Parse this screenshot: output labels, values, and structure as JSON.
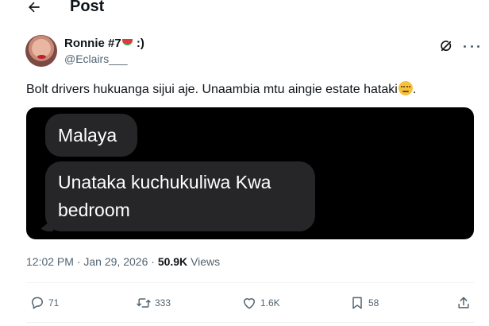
{
  "header": {
    "title": "Post"
  },
  "post": {
    "author_name": "Ronnie #7",
    "author_name_suffix": " :)",
    "handle": "@Eclairs___",
    "text": "Bolt drivers hukuanga sijui aje.  Unaambia mtu aingie estate hataki",
    "text_end": ".",
    "image_messages": [
      "Malaya",
      "Unataka kuchukuliwa Kwa bedroom"
    ],
    "time": "12:02 PM",
    "separator": "·",
    "date": "Jan 29, 2026",
    "views_count": "50.9K",
    "views_label": "Views"
  },
  "actions": {
    "replies": "71",
    "reposts": "333",
    "likes": "1.6K",
    "bookmarks": "58"
  },
  "icons": [
    "back-arrow-icon",
    "watermelon-emoji-icon",
    "grok-icon",
    "more-icon",
    "unamused-emoji-icon",
    "reply-icon",
    "repost-icon",
    "like-icon",
    "bookmark-icon",
    "share-icon"
  ],
  "colors": {
    "text": "#0f1419",
    "secondary": "#536471",
    "bubble": "#262628",
    "media_bg": "#000000"
  }
}
